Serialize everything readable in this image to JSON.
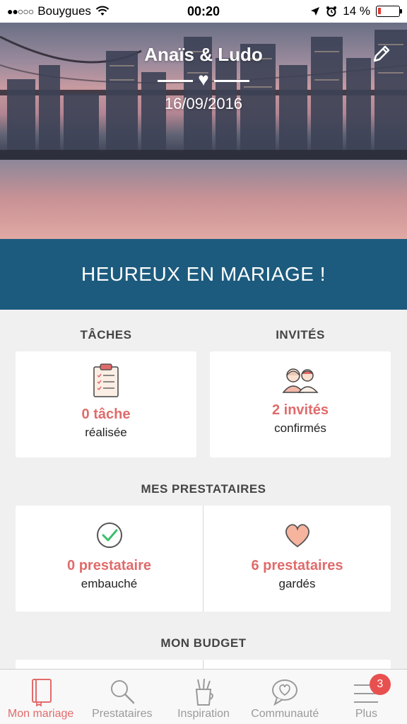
{
  "status_bar": {
    "signal": "●●○○○",
    "carrier": "Bouygues",
    "time": "00:20",
    "battery_percent": "14 %",
    "battery_level": 0.14
  },
  "hero": {
    "couple_names": "Anaïs & Ludo",
    "date": "16/09/2016"
  },
  "banner": {
    "text": "HEUREUX EN MARIAGE !"
  },
  "sections": {
    "taches_title": "TÂCHES",
    "invites_title": "INVITÉS",
    "prestataires_title": "MES PRESTATAIRES",
    "budget_title": "MON BUDGET"
  },
  "cards": {
    "taches": {
      "value": "0 tâche",
      "label": "réalisée"
    },
    "invites": {
      "value": "2 invités",
      "label": "confirmés"
    },
    "embauche": {
      "value": "0 prestataire",
      "label": "embauché"
    },
    "gardes": {
      "value": "6 prestataires",
      "label": "gardés"
    }
  },
  "tab_bar": {
    "tabs": [
      {
        "label": "Mon mariage",
        "icon": "notebook-icon",
        "active": true
      },
      {
        "label": "Prestataires",
        "icon": "search-icon",
        "active": false
      },
      {
        "label": "Inspiration",
        "icon": "pencil-cup-icon",
        "active": false
      },
      {
        "label": "Communauté",
        "icon": "chat-heart-icon",
        "active": false
      },
      {
        "label": "Plus",
        "icon": "menu-icon",
        "active": false,
        "badge": "3"
      }
    ]
  },
  "colors": {
    "accent": "#e06b6b",
    "banner": "#1c5b7e",
    "background": "#f0f0f0"
  }
}
